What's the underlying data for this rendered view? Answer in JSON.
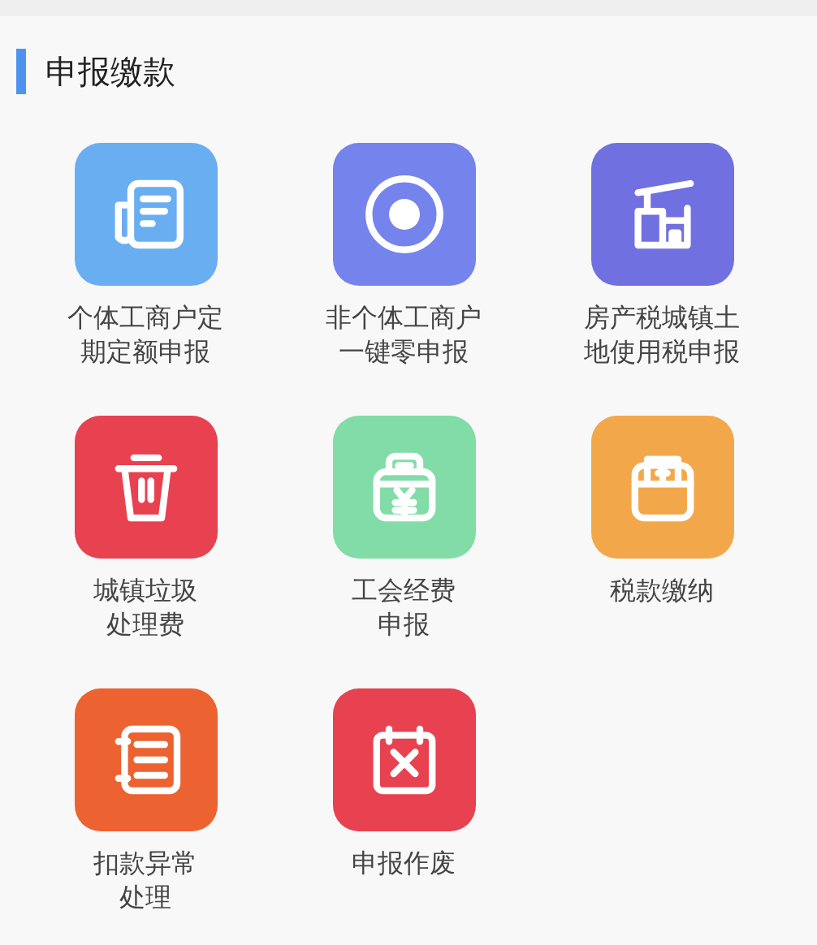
{
  "section": {
    "title": "申报缴款"
  },
  "items": [
    {
      "label_lines": [
        "个体工商户定",
        "期定额申报"
      ],
      "kind": "document",
      "color": "#6aaef2"
    },
    {
      "label_lines": [
        "非个体工商户",
        "一键零申报"
      ],
      "kind": "target",
      "color": "#7583ec"
    },
    {
      "label_lines": [
        "房产税城镇土",
        "地使用税申报"
      ],
      "kind": "house",
      "color": "#7070e0"
    },
    {
      "label_lines": [
        "城镇垃圾",
        "处理费"
      ],
      "kind": "trash",
      "color": "#e84150"
    },
    {
      "label_lines": [
        "工会经费",
        "申报"
      ],
      "kind": "register",
      "color": "#82dca8"
    },
    {
      "label_lines": [
        "税款缴纳"
      ],
      "kind": "wallet",
      "color": "#f2a84a"
    },
    {
      "label_lines": [
        "扣款异常",
        "处理"
      ],
      "kind": "notebook",
      "color": "#ec6230"
    },
    {
      "label_lines": [
        "申报作废"
      ],
      "kind": "calendar",
      "color": "#e84150"
    }
  ]
}
